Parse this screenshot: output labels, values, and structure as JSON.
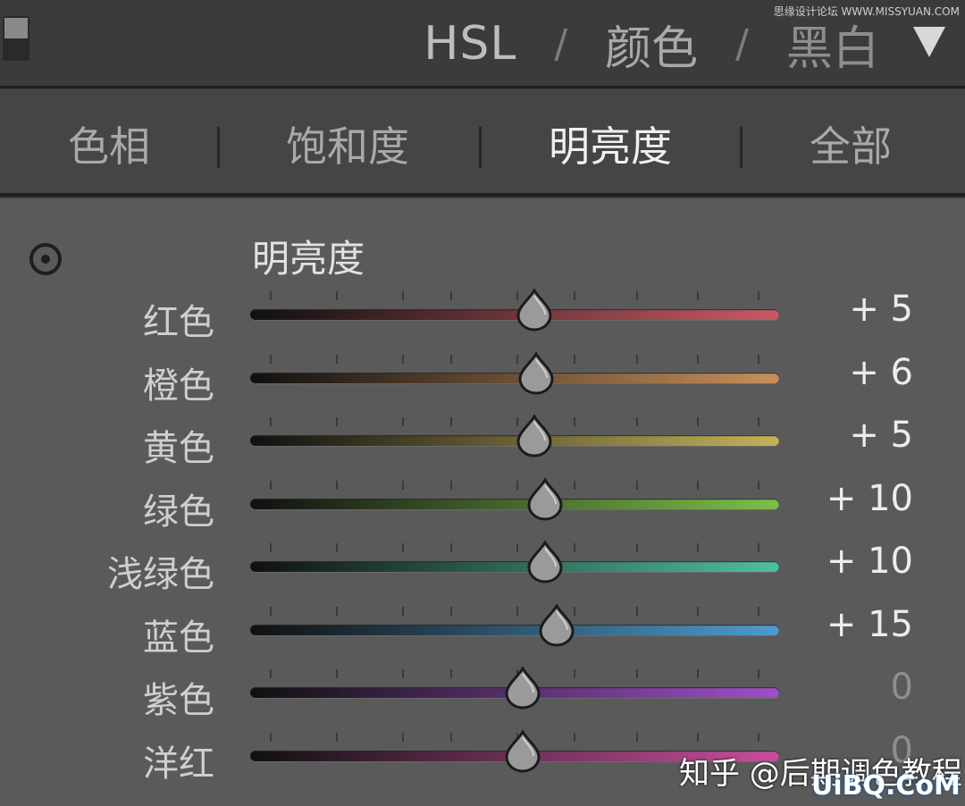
{
  "header": {
    "tab_hsl": "HSL",
    "separator": "/",
    "tab_color": "颜色",
    "tab_bw": "黑白",
    "watermark": "思缘设计论坛 WWW.MISSYUAN.COM"
  },
  "subtabs": [
    {
      "label": "色相",
      "active": false
    },
    {
      "label": "饱和度",
      "active": false
    },
    {
      "label": "明亮度",
      "active": true
    },
    {
      "label": "全部",
      "active": false
    }
  ],
  "panel": {
    "section_title": "明亮度",
    "range": [
      -100,
      100
    ],
    "sliders": [
      {
        "label": "红色",
        "value": "+ 5",
        "numeric": 5,
        "color": "#c85a63"
      },
      {
        "label": "橙色",
        "value": "+ 6",
        "numeric": 6,
        "color": "#c8905a"
      },
      {
        "label": "黄色",
        "value": "+ 5",
        "numeric": 5,
        "color": "#c4b35a"
      },
      {
        "label": "绿色",
        "value": "+ 10",
        "numeric": 10,
        "color": "#7cbf4a"
      },
      {
        "label": "浅绿色",
        "value": "+ 10",
        "numeric": 10,
        "color": "#4fbfa0"
      },
      {
        "label": "蓝色",
        "value": "+ 15",
        "numeric": 15,
        "color": "#4e9ccf"
      },
      {
        "label": "紫色",
        "value": "0",
        "numeric": 0,
        "color": "#a04fc8"
      },
      {
        "label": "洋红",
        "value": "0",
        "numeric": 0,
        "color": "#c84f9c"
      }
    ]
  },
  "watermarks": {
    "zhihu": "知乎 @后期调色教程",
    "uibq": "UiBQ.CoM"
  }
}
